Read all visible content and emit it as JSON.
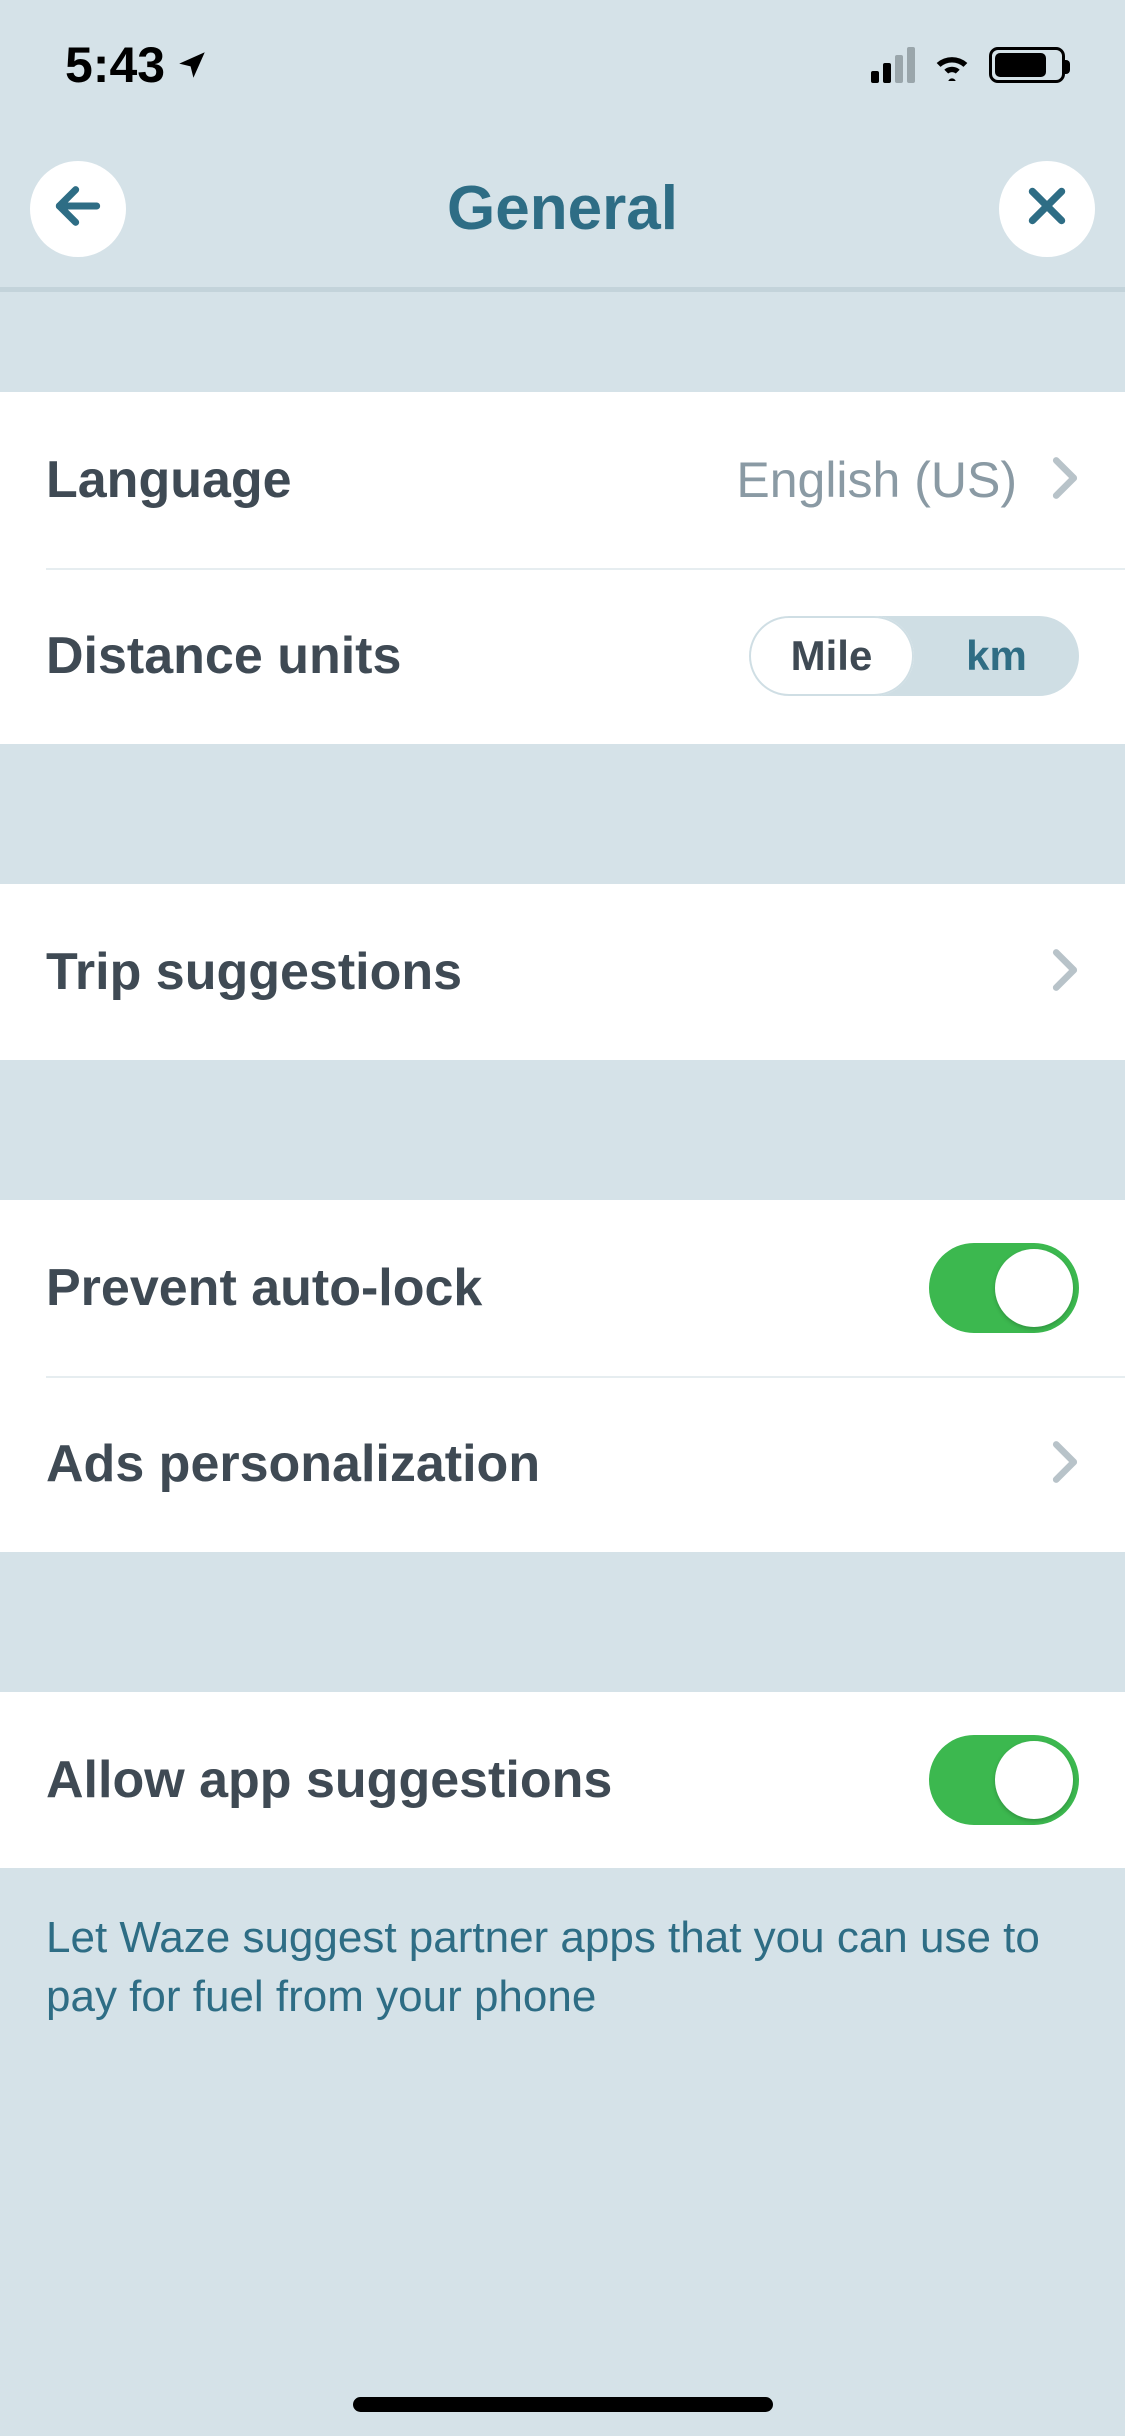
{
  "statusBar": {
    "time": "5:43"
  },
  "header": {
    "title": "General"
  },
  "rows": {
    "language": {
      "label": "Language",
      "value": "English (US)"
    },
    "distance": {
      "label": "Distance units",
      "mile": "Mile",
      "km": "km",
      "selected": "Mile"
    },
    "trip": {
      "label": "Trip suggestions"
    },
    "autolock": {
      "label": "Prevent auto-lock",
      "on": true
    },
    "ads": {
      "label": "Ads personalization"
    },
    "appSuggestions": {
      "label": "Allow app suggestions",
      "on": true
    }
  },
  "footer": {
    "text": "Let Waze suggest partner apps that you can use to pay for fuel from your phone"
  }
}
